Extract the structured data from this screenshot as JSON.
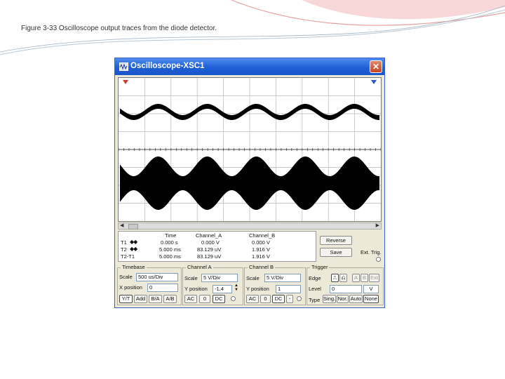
{
  "caption": "Figure 3-33   Oscilloscope output traces from the diode detector.",
  "window": {
    "title": "Oscilloscope-XSC1",
    "close_glyph": "✕"
  },
  "readout": {
    "headers": [
      "Time",
      "Channel_A",
      "Channel_B"
    ],
    "rows": [
      {
        "label": "T1",
        "arrows": "◆◆",
        "time": "0.000 s",
        "a": "0.000 V",
        "b": "0.000 V"
      },
      {
        "label": "T2",
        "arrows": "◆◆",
        "time": "5.000 ms",
        "a": "83.129 uV",
        "b": "1.916 V"
      },
      {
        "label": "T2-T1",
        "arrows": "",
        "time": "5.000 ms",
        "a": "83.129 uV",
        "b": "1.916 V"
      }
    ]
  },
  "buttons": {
    "reverse": "Reverse",
    "save": "Save",
    "ext_trig": "Ext. Trig."
  },
  "timebase": {
    "title": "Timebase",
    "scale_label": "Scale",
    "scale_value": "500 us/Div",
    "xpos_label": "X position",
    "xpos_value": "0",
    "modes": [
      "Y/T",
      "Add",
      "B/A",
      "A/B"
    ]
  },
  "channel_a": {
    "title": "Channel A",
    "scale_label": "Scale",
    "scale_value": "5  V/Div",
    "ypos_label": "Y position",
    "ypos_value": "-1.4",
    "coupling": [
      "AC",
      "0",
      "DC"
    ]
  },
  "channel_b": {
    "title": "Channel B",
    "scale_label": "Scale",
    "scale_value": "5  V/Div",
    "ypos_label": "Y position",
    "ypos_value": "1",
    "coupling": [
      "AC",
      "0",
      "DC",
      "-"
    ]
  },
  "trigger": {
    "title": "Trigger",
    "edge_label": "Edge",
    "edge_buttons": [
      "⎍",
      "⎌",
      "A",
      "B",
      "Ext"
    ],
    "level_label": "Level",
    "level_value": "0",
    "level_unit": "V",
    "type_label": "Type",
    "types": [
      "Sing.",
      "Nor.",
      "Auto",
      "None"
    ]
  },
  "colors": {
    "titlebar": "#1f5fd6",
    "close": "#c8431f",
    "trace": "#000000",
    "grid": "#b8b8b8"
  }
}
